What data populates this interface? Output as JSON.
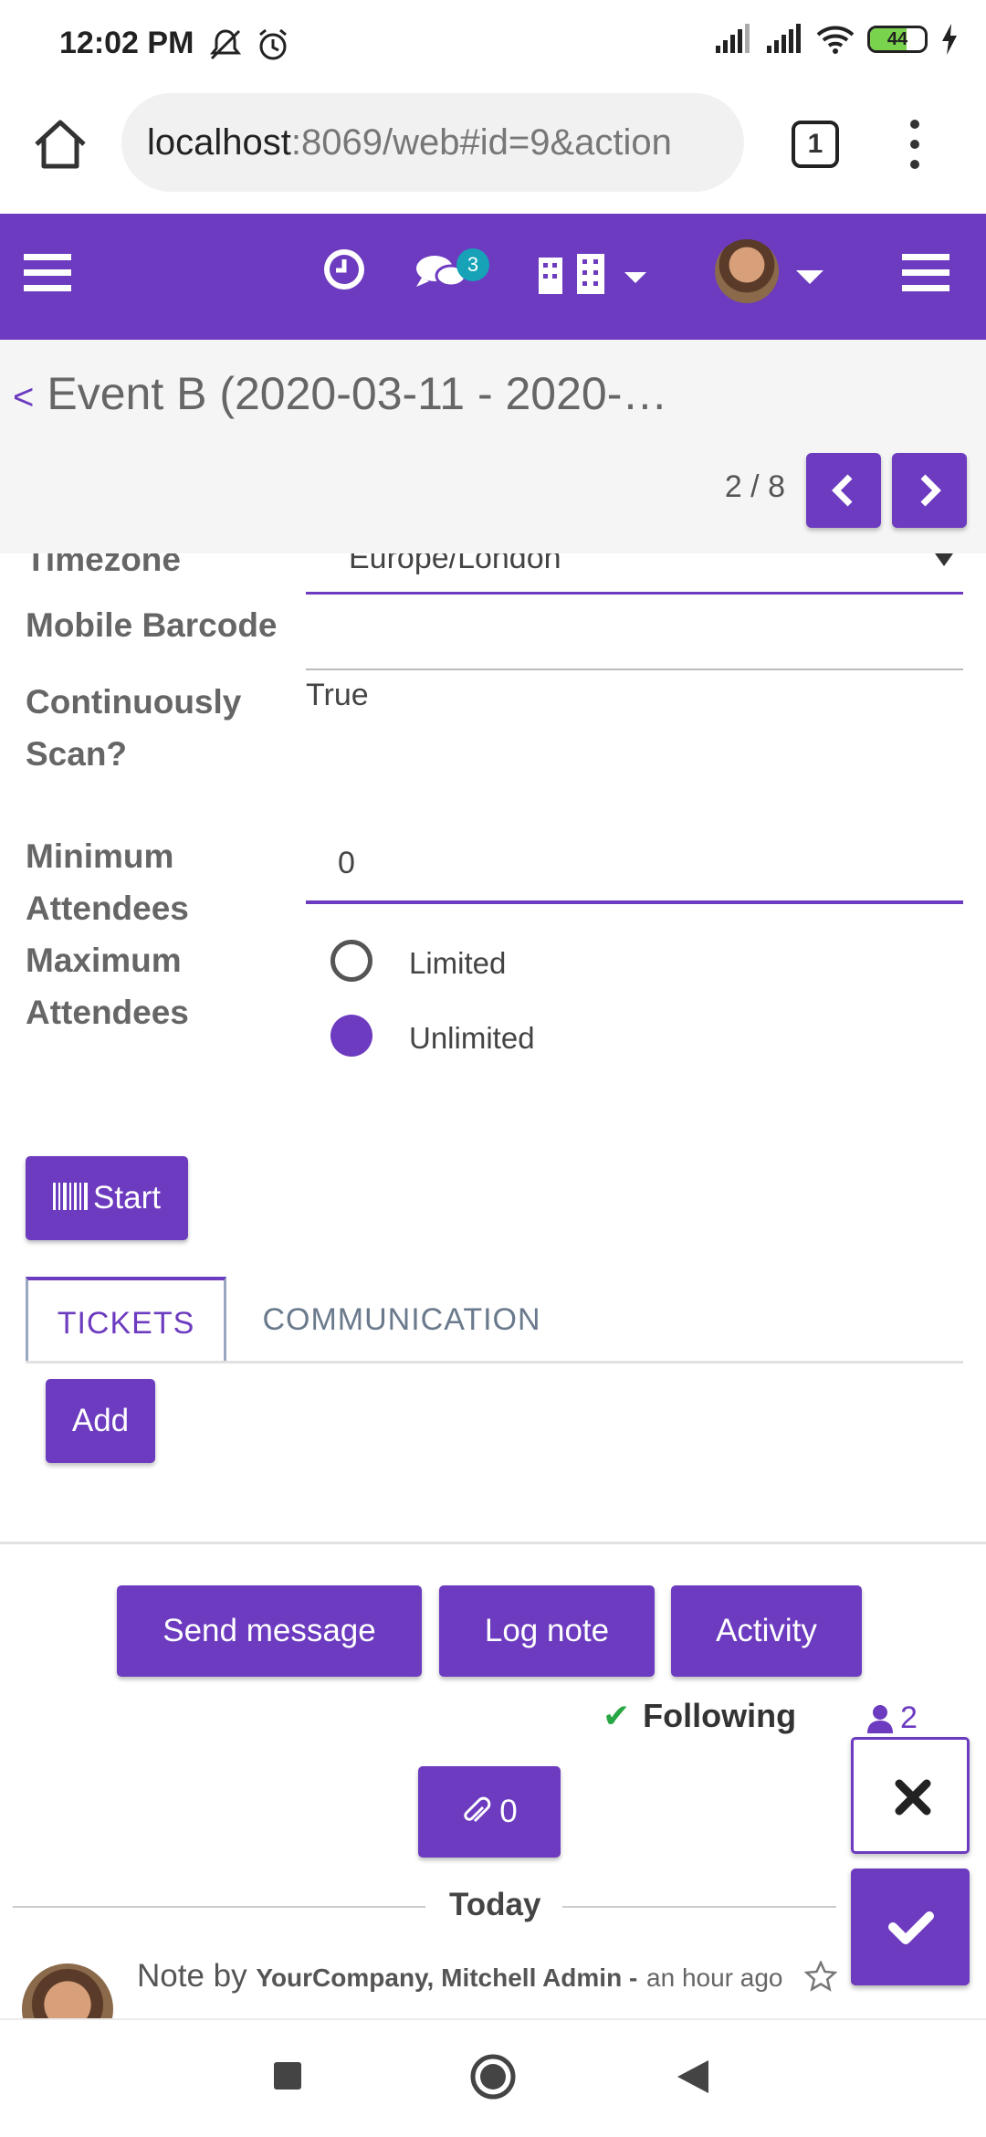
{
  "status_bar": {
    "time": "12:02 PM",
    "battery": "44"
  },
  "browser": {
    "url_host": "localhost",
    "url_rest": ":8069/web#id=9&action",
    "tab_count": "1"
  },
  "navbar": {
    "messages_badge": "3"
  },
  "control_panel": {
    "breadcrumb": "Event B (2020-03-11 - 2020-…",
    "pager": "2 / 8"
  },
  "form": {
    "timezone_label": "Timezone",
    "timezone_value": "Europe/London",
    "mobile_barcode_label": "Mobile Barcode",
    "continuous_scan_label_1": "Continuously",
    "continuous_scan_label_2": "Scan?",
    "continuous_scan_value": "True",
    "min_attendees_label_1": "Minimum",
    "min_attendees_label_2": "Attendees",
    "min_attendees_value": "0",
    "max_attendees_label_1": "Maximum",
    "max_attendees_label_2": "Attendees",
    "radio_limited": "Limited",
    "radio_unlimited": "Unlimited",
    "start_button": "Start",
    "tabs": [
      {
        "label": "TICKETS"
      },
      {
        "label": "COMMUNICATION"
      }
    ],
    "add_button": "Add"
  },
  "chatter": {
    "send_message": "Send message",
    "log_note": "Log note",
    "activity": "Activity",
    "following": "Following",
    "followers_count": "2",
    "attachments_count": "0",
    "today": "Today",
    "note_prefix": "Note by",
    "note_author": "YourCompany, Mitchell Admin -",
    "note_time": "an hour ago"
  },
  "colors": {
    "brand": "#6c3bbf",
    "following_check": "#28a745",
    "badge": "#17a2b8"
  }
}
